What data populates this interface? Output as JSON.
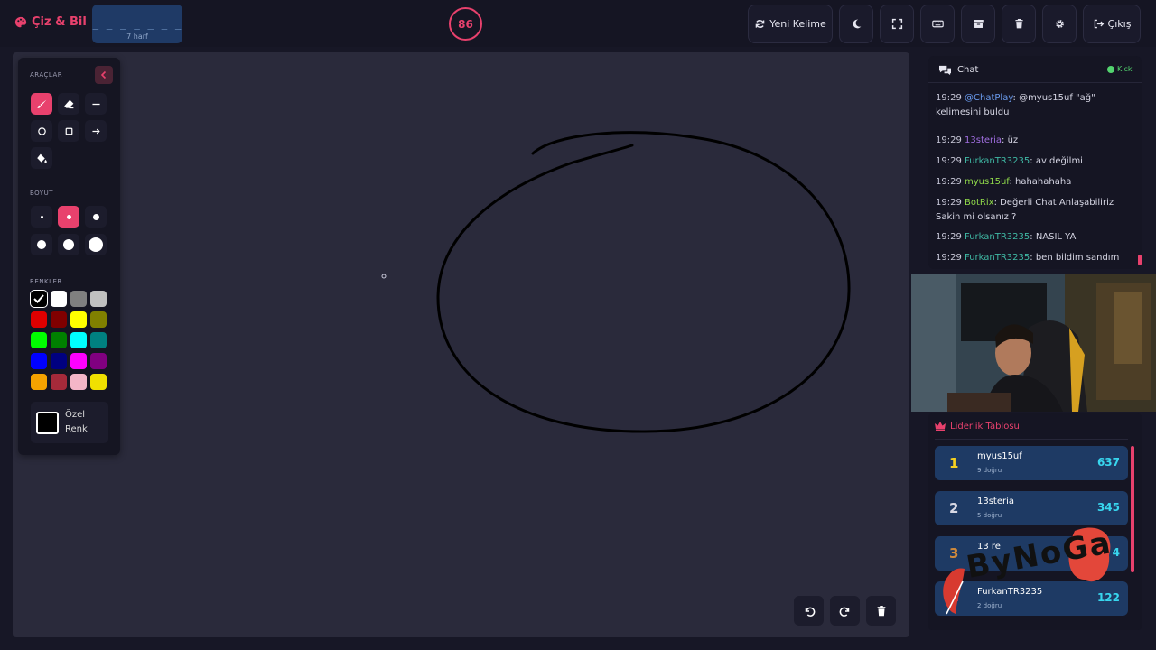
{
  "header": {
    "brand": "Çiz & Bil",
    "word_pattern": "_ _ _ _ _ _ _",
    "word_length": "7 harf",
    "timer": "86",
    "new_word_label": "Yeni Kelime",
    "exit_label": "Çıkış",
    "icons": [
      "refresh-icon",
      "moon-icon",
      "fullscreen-icon",
      "keyboard-icon",
      "archive-icon",
      "trash-icon",
      "gear-icon",
      "logout-icon"
    ]
  },
  "tools": {
    "tools_label": "ARAÇLAR",
    "size_label": "BOYUT",
    "colors_label": "RENKLER",
    "custom_color_label": "Özel Renk",
    "tool_icons": [
      "brush-icon",
      "eraser-icon",
      "line-icon",
      "circle-icon",
      "square-icon",
      "arrow-icon",
      "fill-bucket-icon"
    ],
    "selected_size_index": 1,
    "swatches": [
      "#000000",
      "#ffffff",
      "#808080",
      "#c0c0c0",
      "#e00000",
      "#800000",
      "#ffff00",
      "#808000",
      "#00ff00",
      "#008000",
      "#00ffff",
      "#008080",
      "#0000ff",
      "#000080",
      "#ff00ff",
      "#800080",
      "#f5a300",
      "#a52a3a",
      "#f4b6c8",
      "#f0e000"
    ]
  },
  "chat": {
    "title": "Chat",
    "status": "Kick",
    "messages": [
      {
        "time": "19:29",
        "user": "@ChatPlay",
        "user_color": "#6a9cf0",
        "text": ": @myus15uf \"ağ\" kelimesini buldu!"
      },
      {
        "time": "19:29",
        "user": "13steria",
        "user_color": "#a06ee0",
        "text": ": üz"
      },
      {
        "time": "19:29",
        "user": "FurkanTR3235",
        "user_color": "#3fb8a4",
        "text": ": av değilmi"
      },
      {
        "time": "19:29",
        "user": "myus15uf",
        "user_color": "#8fd84a",
        "text": ": hahahahaha"
      },
      {
        "time": "19:29",
        "user": "BotRix",
        "user_color": "#8fd84a",
        "text": ": Değerli Chat Anlaşabiliriz Sakin mi olsanız ?"
      },
      {
        "time": "19:29",
        "user": "FurkanTR3235",
        "user_color": "#3fb8a4",
        "text": ": NASIL YA"
      },
      {
        "time": "19:29",
        "user": "FurkanTR3235",
        "user_color": "#3fb8a4",
        "text": ": ben bildim sandım"
      }
    ]
  },
  "leaderboard": {
    "title": "Liderlik Tablosu",
    "rows": [
      {
        "rank": "1",
        "rank_color": "#f5d020",
        "name": "myus15uf",
        "sub": "9 doğru",
        "score": "637"
      },
      {
        "rank": "2",
        "rank_color": "#d8d8e4",
        "name": "13steria",
        "sub": "5 doğru",
        "score": "345"
      },
      {
        "rank": "3",
        "rank_color": "#d08a3c",
        "name": "13 re",
        "sub": "",
        "score": "4"
      },
      {
        "rank": "4",
        "rank_color": "#e8416d",
        "name": "FurkanTR3235",
        "sub": "2 doğru",
        "score": "122"
      }
    ]
  },
  "overlay": {
    "watermark": "ByNoGa"
  },
  "canvas_controls": {
    "icons": [
      "undo-icon",
      "redo-icon",
      "trash-icon"
    ]
  }
}
